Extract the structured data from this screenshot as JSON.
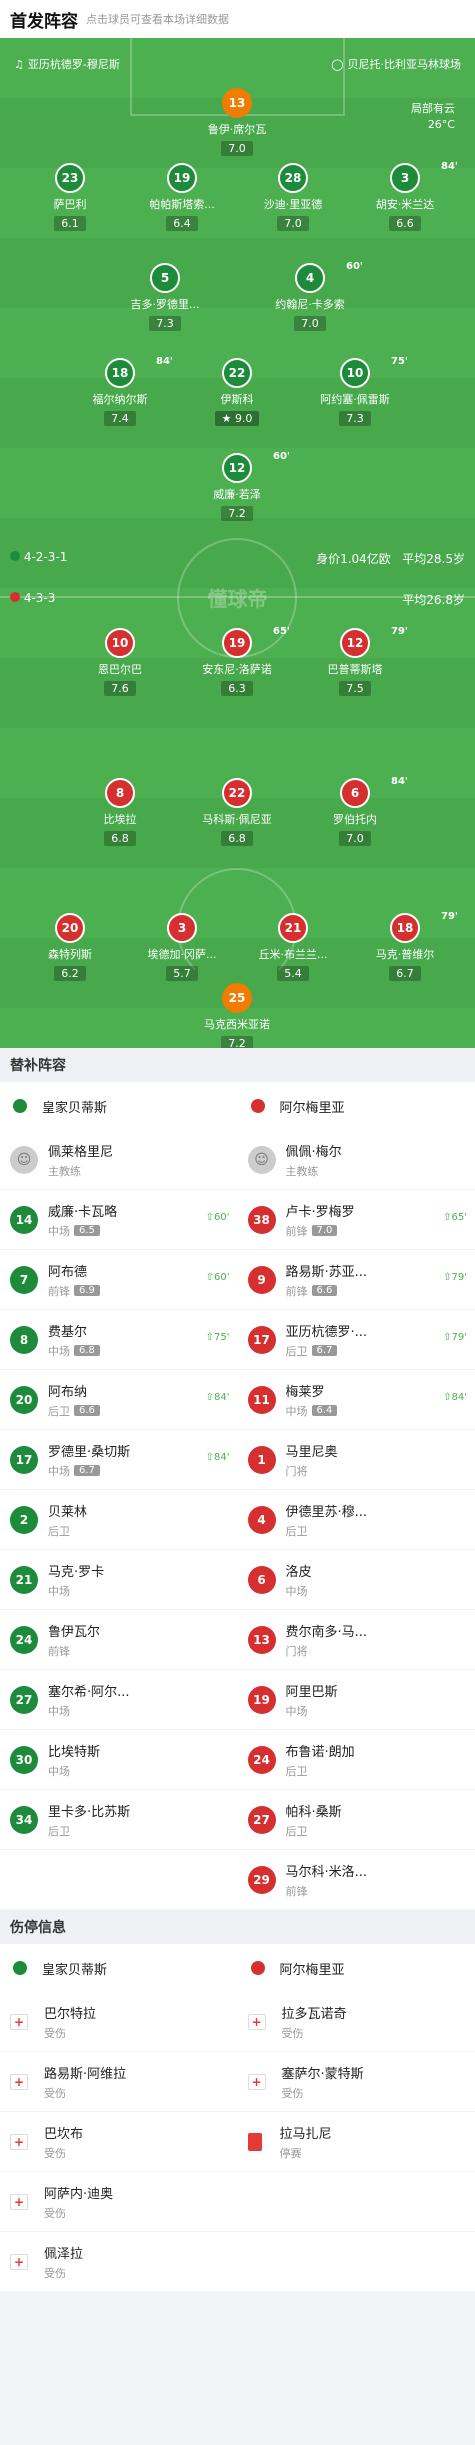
{
  "header": {
    "title": "首发阵容",
    "subtitle": "点击球员可查看本场详细数据"
  },
  "pitch": {
    "match_time": "亚历杭德罗-穆尼斯",
    "venue": "贝尼托·比利亚马林球场",
    "weather": "局部有云",
    "temperature": "26°C",
    "watermark": "懂球帝",
    "home_formation": "4-2-3-1",
    "home_value": "身价1.04亿欧",
    "home_age": "平均28.5岁",
    "away_formation": "4-3-3",
    "away_age": "平均26.8岁",
    "home_players": [
      {
        "num": "13",
        "name": "鲁伊·席尔瓦",
        "rating": "7.0"
      },
      {
        "num": "23",
        "name": "萨巴利",
        "rating": "6.1"
      },
      {
        "num": "19",
        "name": "帕帕斯塔索...",
        "rating": "6.4"
      },
      {
        "num": "28",
        "name": "沙迪·里亚德",
        "rating": "7.0"
      },
      {
        "num": "3",
        "name": "胡安·米兰达",
        "rating": "6.6",
        "sub": "84'"
      },
      {
        "num": "5",
        "name": "吉多·罗德里...",
        "rating": "7.3"
      },
      {
        "num": "4",
        "name": "约翰尼·卡多索",
        "rating": "7.0",
        "sub": "60'"
      },
      {
        "num": "18",
        "name": "福尔纳尔斯",
        "rating": "7.4",
        "sub": "84'"
      },
      {
        "num": "22",
        "name": "伊斯科",
        "rating": "9.0"
      },
      {
        "num": "10",
        "name": "阿约塞·佩雷斯",
        "rating": "7.3",
        "sub": "75'"
      },
      {
        "num": "12",
        "name": "威廉·若泽",
        "rating": "7.2",
        "sub": "60'"
      }
    ],
    "away_players": [
      {
        "num": "10",
        "name": "恩巴尔巴",
        "rating": "7.6"
      },
      {
        "num": "19",
        "name": "安东尼·洛萨诺",
        "rating": "6.3",
        "sub": "65'"
      },
      {
        "num": "12",
        "name": "巴普蒂斯塔",
        "rating": "7.5",
        "sub": "79'"
      },
      {
        "num": "8",
        "name": "比埃拉",
        "rating": "6.8"
      },
      {
        "num": "22",
        "name": "马科斯·佩尼亚",
        "rating": "6.8"
      },
      {
        "num": "6",
        "name": "罗伯托内",
        "rating": "7.0",
        "sub": "84'"
      },
      {
        "num": "20",
        "name": "森特列斯",
        "rating": "6.2"
      },
      {
        "num": "3",
        "name": "埃德加·冈萨...",
        "rating": "5.7"
      },
      {
        "num": "21",
        "name": "丘米·布兰兰...",
        "rating": "5.4"
      },
      {
        "num": "18",
        "name": "马克·普维尔",
        "rating": "6.7",
        "sub": "79'"
      },
      {
        "num": "25",
        "name": "马克西米亚诺",
        "rating": "7.2"
      }
    ]
  },
  "subs": {
    "title": "替补阵容",
    "home_team": "皇家贝蒂斯",
    "away_team": "阿尔梅里亚",
    "home_coach": {
      "name": "佩莱格里尼",
      "role": "主教练"
    },
    "away_coach": {
      "name": "佩佩·梅尔",
      "role": "主教练"
    },
    "home": [
      {
        "num": "14",
        "name": "威廉·卡瓦略",
        "pos": "中场",
        "rating": "6.5",
        "evt": "60'"
      },
      {
        "num": "7",
        "name": "阿布德",
        "pos": "前锋",
        "rating": "6.9",
        "evt": "60'"
      },
      {
        "num": "8",
        "name": "费基尔",
        "pos": "中场",
        "rating": "6.8",
        "evt": "75'"
      },
      {
        "num": "20",
        "name": "阿布纳",
        "pos": "后卫",
        "rating": "6.6",
        "evt": "84'"
      },
      {
        "num": "17",
        "name": "罗德里·桑切斯",
        "pos": "中场",
        "rating": "6.7",
        "evt": "84'"
      },
      {
        "num": "2",
        "name": "贝莱林",
        "pos": "后卫"
      },
      {
        "num": "21",
        "name": "马克·罗卡",
        "pos": "中场"
      },
      {
        "num": "24",
        "name": "鲁伊瓦尔",
        "pos": "前锋"
      },
      {
        "num": "27",
        "name": "塞尔希·阿尔...",
        "pos": "中场"
      },
      {
        "num": "30",
        "name": "比埃特斯",
        "pos": "中场"
      },
      {
        "num": "34",
        "name": "里卡多·比苏斯",
        "pos": "后卫"
      }
    ],
    "away": [
      {
        "num": "38",
        "name": "卢卡·罗梅罗",
        "pos": "前锋",
        "rating": "7.0",
        "evt": "65'"
      },
      {
        "num": "9",
        "name": "路易斯·苏亚...",
        "pos": "前锋",
        "rating": "6.6",
        "evt": "79'"
      },
      {
        "num": "17",
        "name": "亚历杭德罗·...",
        "pos": "后卫",
        "rating": "6.7",
        "evt": "79'"
      },
      {
        "num": "11",
        "name": "梅莱罗",
        "pos": "中场",
        "rating": "6.4",
        "evt": "84'"
      },
      {
        "num": "1",
        "name": "马里尼奥",
        "pos": "门将"
      },
      {
        "num": "4",
        "name": "伊德里苏·穆...",
        "pos": "后卫"
      },
      {
        "num": "6",
        "name": "洛皮",
        "pos": "中场"
      },
      {
        "num": "13",
        "name": "费尔南多·马...",
        "pos": "门将"
      },
      {
        "num": "19",
        "name": "阿里巴斯",
        "pos": "中场"
      },
      {
        "num": "24",
        "name": "布鲁诺·朗加",
        "pos": "后卫"
      },
      {
        "num": "27",
        "name": "帕科·桑斯",
        "pos": "后卫"
      },
      {
        "num": "29",
        "name": "马尔科·米洛...",
        "pos": "前锋"
      }
    ]
  },
  "injury": {
    "title": "伤停信息",
    "home_team": "皇家贝蒂斯",
    "away_team": "阿尔梅里亚",
    "home": [
      {
        "name": "巴尔特拉",
        "status": "受伤"
      },
      {
        "name": "路易斯·阿维拉",
        "status": "受伤"
      },
      {
        "name": "巴坎布",
        "status": "受伤"
      },
      {
        "name": "阿萨内·迪奥",
        "status": "受伤"
      },
      {
        "name": "佩泽拉",
        "status": "受伤"
      }
    ],
    "away": [
      {
        "name": "拉多瓦诺奇",
        "status": "受伤"
      },
      {
        "name": "塞萨尔·蒙特斯",
        "status": "受伤"
      },
      {
        "name": "拉马扎尼",
        "status": "停赛"
      }
    ]
  }
}
